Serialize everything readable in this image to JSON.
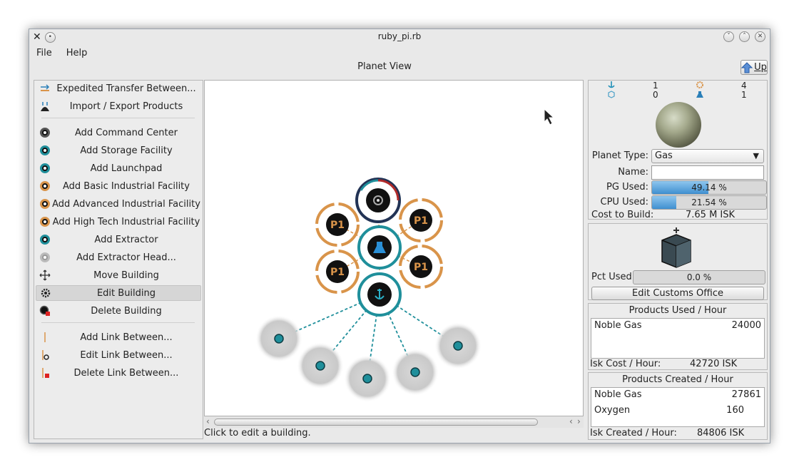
{
  "window": {
    "title": "ruby_pi.rb"
  },
  "menu": {
    "file": "File",
    "help": "Help"
  },
  "view": {
    "title": "Planet View",
    "up_label": "Up"
  },
  "actions": [
    {
      "label": "Expedited Transfer Between...",
      "icon": "expedited-transfer-icon"
    },
    {
      "label": "Import / Export Products",
      "icon": "import-export-icon"
    },
    {
      "label": "Add Command Center",
      "icon": "command-center-icon"
    },
    {
      "label": "Add Storage Facility",
      "icon": "storage-facility-icon"
    },
    {
      "label": "Add Launchpad",
      "icon": "launchpad-icon"
    },
    {
      "label": "Add Basic Industrial Facility",
      "icon": "basic-industrial-icon"
    },
    {
      "label": "Add Advanced Industrial Facility",
      "icon": "advanced-industrial-icon"
    },
    {
      "label": "Add High Tech Industrial Facility",
      "icon": "high-tech-industrial-icon"
    },
    {
      "label": "Add Extractor",
      "icon": "extractor-icon"
    },
    {
      "label": "Add Extractor Head...",
      "icon": "extractor-head-icon"
    },
    {
      "label": "Move Building",
      "icon": "move-icon"
    },
    {
      "label": "Edit Building",
      "icon": "gear-icon"
    },
    {
      "label": "Delete Building",
      "icon": "delete-building-icon"
    },
    {
      "label": "Add Link Between...",
      "icon": "add-link-icon"
    },
    {
      "label": "Edit Link Between...",
      "icon": "edit-link-icon"
    },
    {
      "label": "Delete Link Between...",
      "icon": "delete-link-icon"
    }
  ],
  "canvas": {
    "p1_label": "P1"
  },
  "status": {
    "text": "Click to edit a building."
  },
  "stats": {
    "launchpads": "1",
    "factories": "4",
    "storage": "0",
    "command": "1"
  },
  "planet": {
    "type_label": "Planet Type:",
    "type_value": "Gas",
    "name_label": "Name:",
    "name_value": "",
    "pg_label": "PG Used:",
    "pg_text": "49.14 %",
    "pg_value": 49.14,
    "cpu_label": "CPU Used:",
    "cpu_text": "21.54 %",
    "cpu_value": 21.54,
    "cost_label": "Cost to Build:",
    "cost_value": "7.65 M ISK"
  },
  "customs": {
    "pct_label": "Pct Used:",
    "pct_text": "0.0 %",
    "pct_value": 0,
    "edit_label": "Edit Customs Office"
  },
  "products_used": {
    "title": "Products Used / Hour",
    "rows": [
      {
        "name": "Noble Gas",
        "qty": "24000"
      }
    ],
    "footer_label": "Isk Cost / Hour:",
    "footer_value": "42720 ISK"
  },
  "products_created": {
    "title": "Products Created / Hour",
    "rows": [
      {
        "name": "Noble Gas",
        "qty": "27861"
      },
      {
        "name": "Oxygen",
        "qty": "160"
      }
    ],
    "footer_label": "Isk Created / Hour:",
    "footer_value": "84806 ISK"
  },
  "colors": {
    "teal": "#1f8f9b",
    "orange": "#d9944a",
    "planet_ring": "#223355"
  }
}
